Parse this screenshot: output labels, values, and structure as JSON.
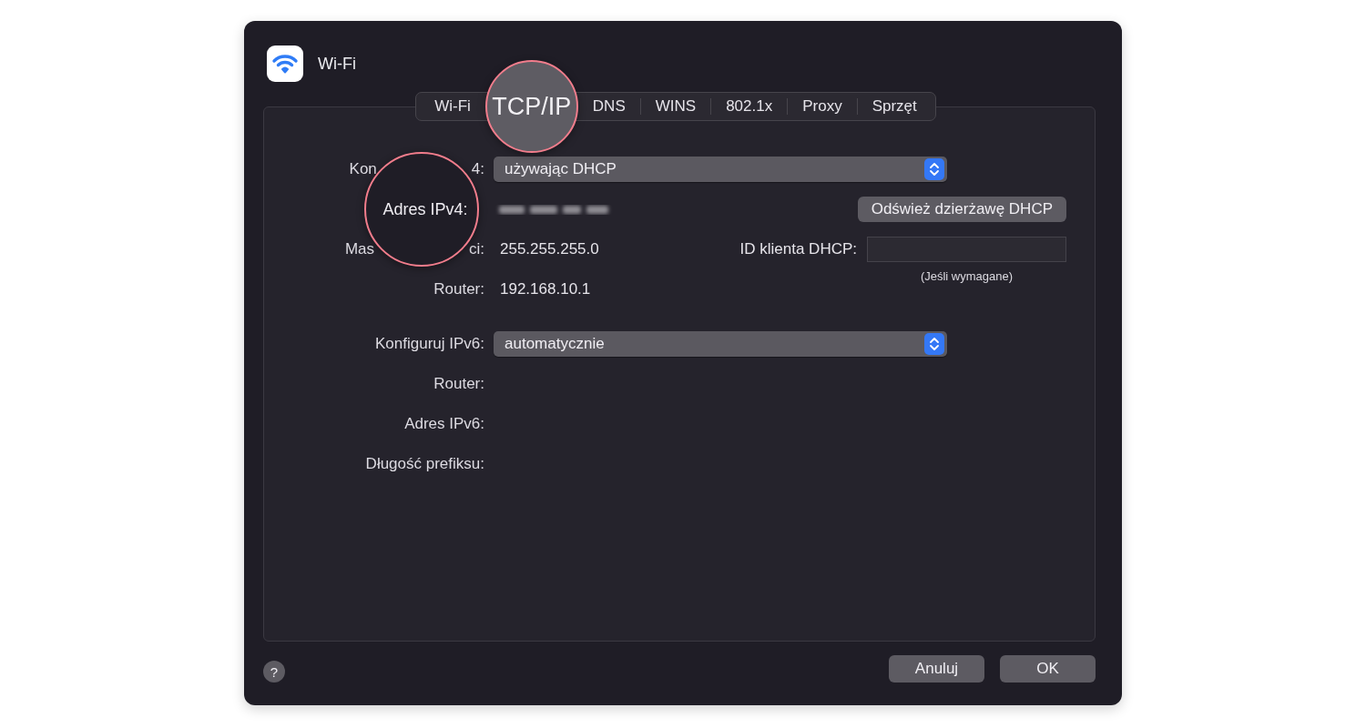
{
  "window": {
    "title": "Wi-Fi"
  },
  "tabs": [
    {
      "label": "Wi-Fi",
      "selected": false
    },
    {
      "label": "TCP/IP",
      "selected": true
    },
    {
      "label": "DNS",
      "selected": false
    },
    {
      "label": "WINS",
      "selected": false
    },
    {
      "label": "802.1x",
      "selected": false
    },
    {
      "label": "Proxy",
      "selected": false
    },
    {
      "label": "Sprzęt",
      "selected": false
    }
  ],
  "ipv4": {
    "configure": {
      "label_parts": [
        "Kon",
        "4:"
      ],
      "value": "używając DHCP"
    },
    "address": {
      "label": "Adres IPv4:"
    },
    "renew_button": "Odśwież dzierżawę DHCP",
    "subnet_mask": {
      "label_parts": [
        "Mas",
        "ci:"
      ],
      "value": "255.255.255.0"
    },
    "dhcp_client_id": {
      "label": "ID klienta DHCP:",
      "hint": "(Jeśli wymagane)"
    },
    "router": {
      "label": "Router:",
      "value": "192.168.10.1"
    }
  },
  "ipv6": {
    "configure": {
      "label": "Konfiguruj IPv6:",
      "value": "automatycznie"
    },
    "router": {
      "label": "Router:"
    },
    "address": {
      "label": "Adres IPv6:"
    },
    "prefix_length": {
      "label": "Długość prefiksu:"
    }
  },
  "help_button": "?",
  "buttons": [
    "Anuluj",
    "OK"
  ]
}
